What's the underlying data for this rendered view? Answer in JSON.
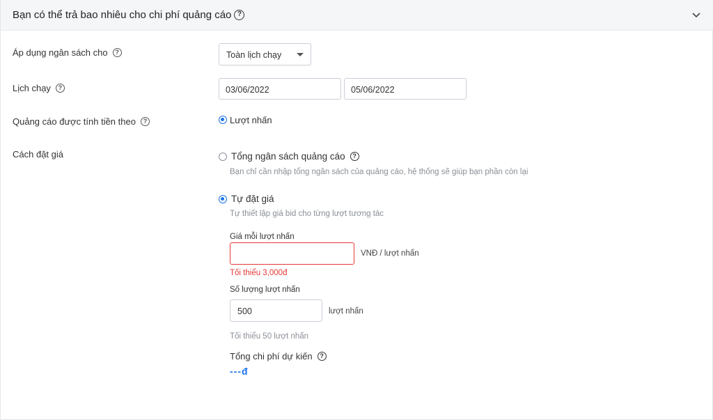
{
  "section": {
    "title": "Bạn có thể trả bao nhiêu cho chi phí quảng cáo",
    "help_icon": "question-circle-icon",
    "collapse_icon": "chevron-down-icon"
  },
  "budget_apply": {
    "label": "Áp dụng ngân sách cho",
    "selected": "Toàn lịch chạy"
  },
  "schedule": {
    "label": "Lịch chạy",
    "start_date": "03/06/2022",
    "end_date": "05/06/2022"
  },
  "billing": {
    "label": "Quảng cáo được tính tiền theo",
    "option": "Lượt nhấn",
    "selected": true
  },
  "bidding": {
    "label": "Cách đặt giá",
    "total_budget": {
      "label": "Tổng ngân sách quảng cáo",
      "description": "Bạn chỉ cần nhập tổng ngân sách của quảng cáo, hệ thống sẽ giúp bạn phần còn lại",
      "selected": false
    },
    "manual": {
      "label": "Tự đặt giá",
      "description": "Tự thiết lập giá bid cho từng lượt tương tác",
      "selected": true,
      "price_per_click": {
        "label": "Giá mỗi lượt nhấn",
        "value": "",
        "unit": "VNĐ / lượt nhấn",
        "error": "Tối thiểu 3,000đ"
      },
      "click_count": {
        "label": "Số lượng lượt nhấn",
        "value": "500",
        "unit": "lượt nhấn",
        "hint": "Tối thiểu 50 lượt nhấn"
      },
      "estimated_total": {
        "label": "Tổng chi phí dự kiến",
        "value": "---đ"
      }
    }
  },
  "colors": {
    "accent": "#1a73e8",
    "error": "#e53935",
    "header_bg": "#f5f6f8"
  }
}
